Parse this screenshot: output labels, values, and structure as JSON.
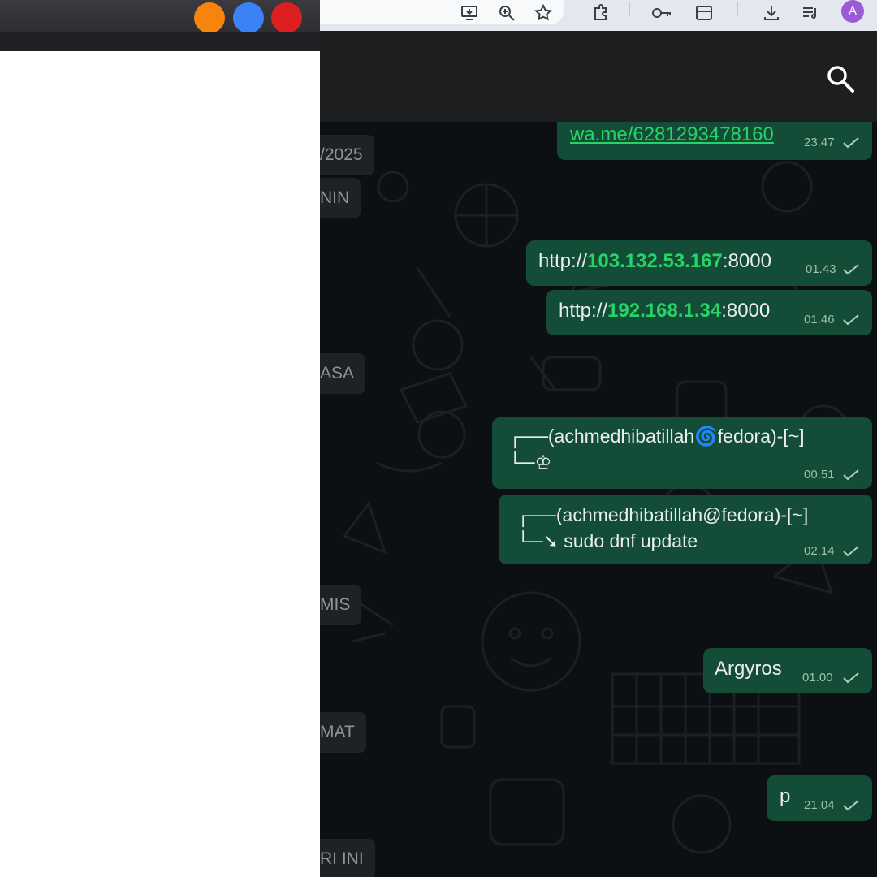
{
  "window": {
    "min_color": "#f7840c",
    "max_color": "#3b82f6",
    "close_color": "#dc1f1f"
  },
  "toolbar": {
    "icons": [
      "install-app-icon",
      "zoom-icon",
      "bookmark-star-icon",
      "extensions-icon",
      "password-key-icon",
      "sidebar-icon",
      "download-icon",
      "reading-list-icon"
    ],
    "profile_initial": "A"
  },
  "header": {
    "search_icon": "search-icon"
  },
  "date_separators": [
    "/2025",
    "NIN",
    "ASA",
    "MIS",
    "MAT",
    "RI INI"
  ],
  "messages": [
    {
      "link": "wa.me/6281293478160",
      "time": "23.47"
    },
    {
      "prefix": "http://",
      "ip": "103.132.53.167",
      "suffix": ":8000",
      "time": "01.43"
    },
    {
      "prefix": "http://",
      "ip": "192.168.1.34",
      "suffix": ":8000",
      "time": "01.46"
    },
    {
      "line1": "┌──(achmedhibatillah🌀fedora)-[~]",
      "line2": "└─♔",
      "time": "00.51"
    },
    {
      "line1": "┌──(achmedhibatillah@fedora)-[~]",
      "line2": "└─➘ sudo dnf update",
      "time": "02.14"
    },
    {
      "text": "Argyros",
      "time": "01.00"
    },
    {
      "text": "p",
      "time": "21.04"
    }
  ],
  "colors": {
    "bubble": "#144d37",
    "accent": "#25d366",
    "header": "#1c1e1f",
    "profile": "#9c5bd6"
  }
}
